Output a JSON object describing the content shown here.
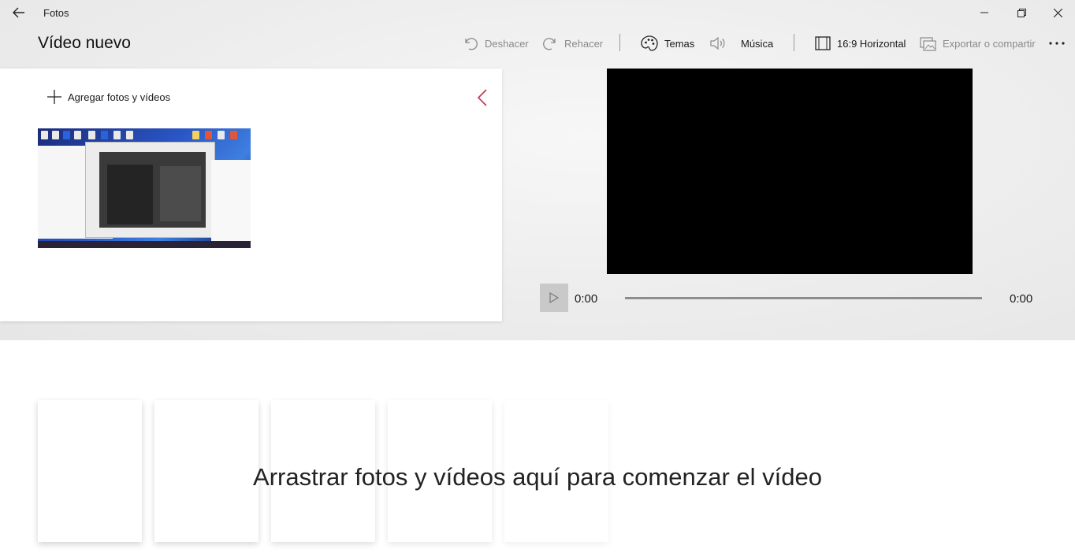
{
  "window": {
    "app_name": "Fotos"
  },
  "page": {
    "title": "Vídeo nuevo"
  },
  "toolbar": {
    "undo_label": "Deshacer",
    "redo_label": "Rehacer",
    "themes_label": "Temas",
    "music_label": "Música",
    "aspect_label": "16:9 Horizontal",
    "export_label": "Exportar o compartir"
  },
  "library": {
    "add_label": "Agregar fotos y vídeos"
  },
  "player": {
    "current_time": "0:00",
    "total_time": "0:00",
    "progress": 0
  },
  "storyboard": {
    "drop_message": "Arrastrar fotos y vídeos aquí para comenzar el vídeo"
  },
  "colors": {
    "accent": "#c4314b",
    "preview_bg": "#000000"
  }
}
